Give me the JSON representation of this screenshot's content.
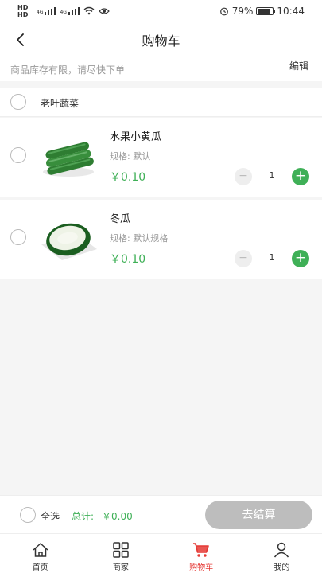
{
  "status_bar": {
    "sim1": "HD",
    "sim2": "HD",
    "net1": "4G",
    "net2": "4G",
    "battery": "79%",
    "battery_level": 0.79,
    "time": "10:44"
  },
  "header": {
    "title": "购物车"
  },
  "notice": {
    "text": "商品库存有限，请尽快下单",
    "edit_label": "编辑"
  },
  "shop": {
    "name": "老叶蔬菜"
  },
  "items": [
    {
      "name": "水果小黄瓜",
      "spec": "规格: 默认",
      "price": "￥0.10",
      "quantity": "1",
      "minus": "−",
      "plus": "+"
    },
    {
      "name": "冬瓜",
      "spec": "规格: 默认规格",
      "price": "￥0.10",
      "quantity": "1",
      "minus": "−",
      "plus": "+"
    }
  ],
  "checkout": {
    "select_all": "全选",
    "total_label": "总计:",
    "total_value": "￥0.00",
    "pay_label": "去结算"
  },
  "tabs": [
    {
      "label": "首页",
      "icon": "home-icon"
    },
    {
      "label": "商家",
      "icon": "grid-icon"
    },
    {
      "label": "购物车",
      "icon": "cart-icon",
      "active": true
    },
    {
      "label": "我的",
      "icon": "user-icon"
    }
  ],
  "colors": {
    "accent": "#3fb057",
    "active_tab": "#e53935",
    "disabled_button": "#bdbdbd"
  }
}
